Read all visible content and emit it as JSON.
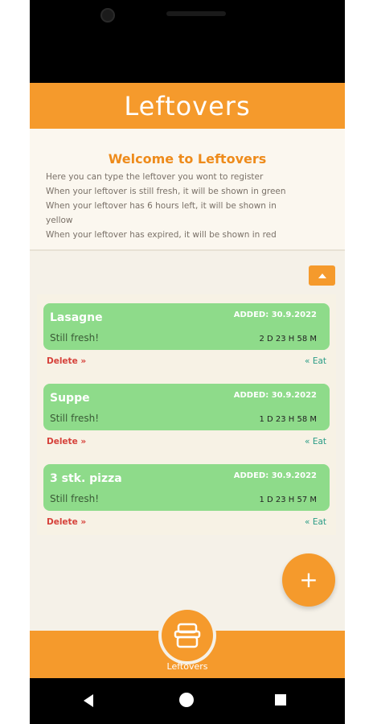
{
  "app": {
    "title": "Leftovers"
  },
  "welcome": {
    "title": "Welcome to Leftovers",
    "lines": [
      "Here you can type the leftover you wont to register",
      "When your leftover is still fresh, it will be shown in green",
      "When your leftover has 6 hours left, it will be shown in",
      "yellow",
      "When your leftover has expired, it will be shown in red"
    ]
  },
  "leftovers": [
    {
      "name": "Lasagne",
      "added": "ADDED: 30.9.2022",
      "status": "Still fresh!",
      "time_left": "2 D 23 H 58 M",
      "delete_label": "Delete",
      "eat_label": "Eat"
    },
    {
      "name": "Suppe",
      "added": "ADDED: 30.9.2022",
      "status": "Still fresh!",
      "time_left": "1 D 23 H 58 M",
      "delete_label": "Delete",
      "eat_label": "Eat"
    },
    {
      "name": "3 stk. pizza",
      "added": "ADDED: 30.9.2022",
      "status": "Still fresh!",
      "time_left": "1 D 23 H 57 M",
      "delete_label": "Delete",
      "eat_label": "Eat"
    }
  ],
  "bottom_nav": {
    "label": "Leftovers"
  },
  "colors": {
    "accent": "#f59a2c",
    "fresh": "#8edb8a",
    "delete": "#d6413a",
    "eat": "#2a9c86"
  },
  "icons": {
    "toggle": "chevron-up-icon",
    "fab": "plus-icon",
    "nav": "food-container-icon"
  }
}
